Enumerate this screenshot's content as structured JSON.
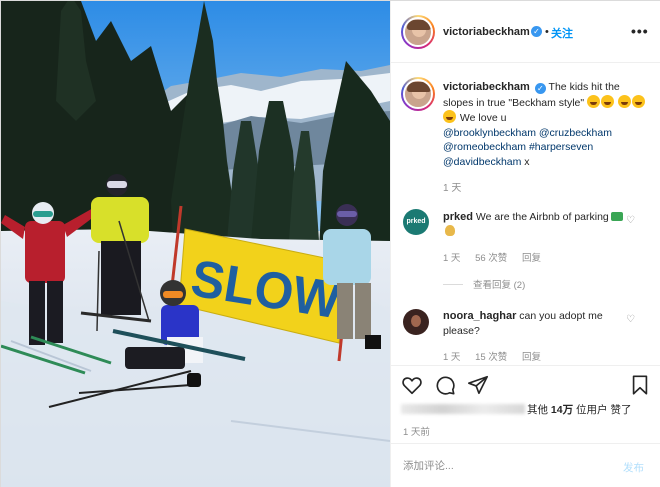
{
  "header": {
    "username": "victoriabeckham",
    "follow_label": "关注",
    "dot": "•",
    "more": "•••"
  },
  "caption": {
    "username": "victoriabeckham",
    "text_part1": " The kids hit the slopes in true \"Beckham style\" ",
    "text_part2": " We love u",
    "mentions": [
      "@brooklynbeckham",
      "@cruzbeckham",
      "@romeobeckham",
      "#harperseven",
      "@davidbeckham"
    ],
    "trailing": " x",
    "time": "1 天"
  },
  "photo": {
    "sign_text": "SLOW"
  },
  "comments": [
    {
      "username": "prked",
      "avatar_text": "prked",
      "text": " We are the Airbnb of parking",
      "time": "1 天",
      "likes": "56 次赞",
      "reply": "回复",
      "view_replies": "查看回复 (2)"
    },
    {
      "username": "noora_haghar",
      "text": " can you adopt me please?",
      "time": "1 天",
      "likes": "15 次赞",
      "reply": "回复"
    }
  ],
  "likes": {
    "text_prefix": "其他 ",
    "count": "14万",
    "text_suffix": " 位用户 赞了"
  },
  "post_time": "1 天前",
  "add_comment": {
    "placeholder": "添加评论...",
    "post_label": "发布"
  },
  "colors": {
    "accent": "#0095f6",
    "verified": "#3897f0",
    "muted": "#8e8e8e",
    "sign_yellow": "#f2d21b",
    "sign_text": "#1f5fa0"
  },
  "icons": [
    "verified-icon",
    "more-icon",
    "heart-icon",
    "comment-icon",
    "share-icon",
    "bookmark-icon",
    "small-heart-icon"
  ]
}
